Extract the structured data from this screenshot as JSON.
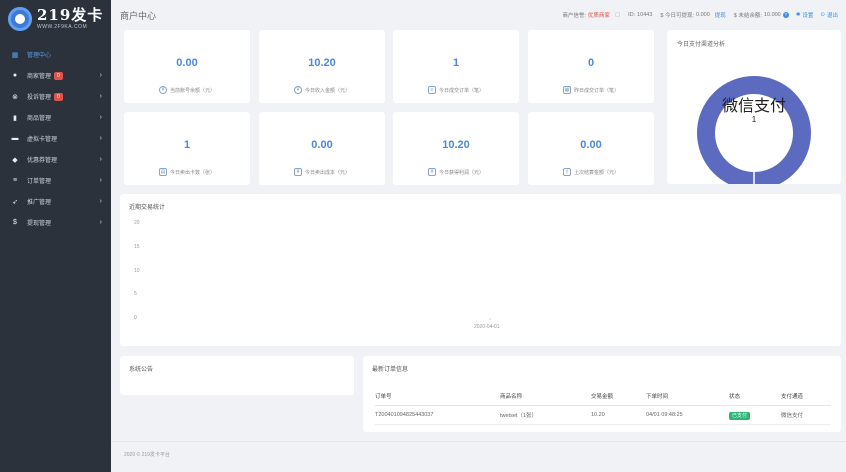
{
  "brand": {
    "name": "219发卡",
    "domain": "WWW.2F9KA.COM"
  },
  "sidebar": {
    "items": [
      {
        "label": "管理中心",
        "icon": "dashboard-icon",
        "glyph": "▦",
        "active": true,
        "badge": "",
        "chevron": false
      },
      {
        "label": "商家管理",
        "icon": "user-icon",
        "glyph": "●",
        "active": false,
        "badge": "0",
        "chevron": true
      },
      {
        "label": "投诉管理",
        "icon": "warning-icon",
        "glyph": "⊗",
        "active": false,
        "badge": "0",
        "chevron": true
      },
      {
        "label": "商品管理",
        "icon": "shopping-bag-icon",
        "glyph": "▮",
        "active": false,
        "badge": "",
        "chevron": true
      },
      {
        "label": "虚拟卡管理",
        "icon": "card-icon",
        "glyph": "▬",
        "active": false,
        "badge": "",
        "chevron": true
      },
      {
        "label": "优惠券管理",
        "icon": "tag-icon",
        "glyph": "◆",
        "active": false,
        "badge": "",
        "chevron": true
      },
      {
        "label": "订单管理",
        "icon": "list-icon",
        "glyph": "≡",
        "active": false,
        "badge": "",
        "chevron": true
      },
      {
        "label": "推广管理",
        "icon": "send-icon",
        "glyph": "➶",
        "active": false,
        "badge": "",
        "chevron": true
      },
      {
        "label": "提现管理",
        "icon": "dollar-icon",
        "glyph": "$",
        "active": false,
        "badge": "",
        "chevron": true
      }
    ]
  },
  "header": {
    "title": "商户中心",
    "merchant_label": "商户信誉:",
    "merchant_value": "优质商家",
    "id_label": "ID:",
    "id_value": "10443",
    "withdraw_label": "$ 今日可提现:",
    "withdraw_value": "0.000",
    "withdraw_link": "提现",
    "unsettled_label": "$ 未结余额:",
    "unsettled_value": "10.000",
    "settings_label": "设置",
    "logout_label": "退出"
  },
  "stats": [
    {
      "value": "0.00",
      "label": "当前账号余额（元）",
      "icon": "wallet-icon",
      "glyph": "¥"
    },
    {
      "value": "10.20",
      "label": "今日收入金额（元）",
      "icon": "income-icon",
      "glyph": "¥"
    },
    {
      "value": "1",
      "label": "今日成交订单（笔）",
      "icon": "order-icon",
      "glyph": "≡"
    },
    {
      "value": "0",
      "label": "昨日成交订单（笔）",
      "icon": "calendar-icon",
      "glyph": "▦"
    },
    {
      "value": "1",
      "label": "今日卖出卡数（张）",
      "icon": "cards-icon",
      "glyph": "▤"
    },
    {
      "value": "0.00",
      "label": "今日卖出成本（元）",
      "icon": "cost-icon",
      "glyph": "¥"
    },
    {
      "value": "10.20",
      "label": "今日获得利润（元）",
      "icon": "profit-icon",
      "glyph": "¥"
    },
    {
      "value": "0.00",
      "label": "上次结算金额（元）",
      "icon": "settlement-icon",
      "glyph": "⇧"
    }
  ],
  "pie": {
    "title": "今日支付渠道分析",
    "center_label": "微信支付",
    "center_value": "1",
    "color": "#5c6bc0"
  },
  "chart_data": {
    "type": "line",
    "title": "近期交易统计",
    "x": [
      "2020-04-01"
    ],
    "series": [
      {
        "values": [
          0
        ]
      }
    ],
    "ylim": [
      0,
      20
    ],
    "yticks": [
      "20",
      "15",
      "10",
      "5",
      "0"
    ],
    "grid": false
  },
  "notice": {
    "title": "系统公告"
  },
  "orders": {
    "title": "最新订单信息",
    "columns": [
      "订单号",
      "商品名称",
      "交易金额",
      "下单时间",
      "状态",
      "支付通道"
    ],
    "rows": [
      {
        "order_no": "T200401094825443037",
        "product": "twetset（1张）",
        "amount": "10.20",
        "time": "04/01 09:48:25",
        "status": "已支付",
        "channel": "微信支付"
      }
    ]
  },
  "footer": {
    "text": "2020 © 219发卡平台"
  }
}
